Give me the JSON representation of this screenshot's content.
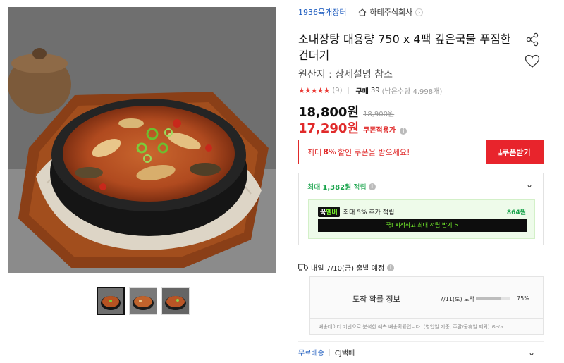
{
  "breadcrumb": {
    "brand": "1936육개장터",
    "seller": "하테주식회사"
  },
  "product": {
    "title": "소내장탕 대용량 750 x 4팩 깊은국물 푸짐한 건더기",
    "origin": "원산지 : 상세설명 참조",
    "rating_stars": "★★★★★",
    "review_count": "(9)",
    "purchase_label": "구매",
    "purchase_count": "39",
    "remaining": "(남은수량 4,998개)",
    "price": "18,800원",
    "original_price": "18,900원",
    "coupon_price": "17,290원",
    "coupon_tag": "쿠폰적용가"
  },
  "coupon_banner": {
    "text_prefix": "최대",
    "text_percent": "8%",
    "text_suffix": "할인 쿠폰을 받으세요!",
    "button_label": "⤓쿠폰받기"
  },
  "reward": {
    "prefix": "최대",
    "amount": "1,382원",
    "suffix": "적립",
    "member_logo_a": "꾹",
    "member_logo_b": "멤버",
    "member_desc": "최대 5% 추가 적립",
    "member_amount": "864원",
    "member_cta": "꾹! 시작하고 최대 적립 받기 >"
  },
  "shipping": {
    "dispatch": "내일 7/10(금) 출발 예정",
    "arrival_title": "도착 확률 정보",
    "arrival_date": "7/11(토) 도착",
    "arrival_probability_pct": 75,
    "arrival_pct_label": "75%",
    "arrival_note": "배송데이터 기반으로 분석한 예측 배송확률입니다. (영업일 기준, 주말/공휴일 제외)",
    "beta_label": "Beta",
    "free_shipping": "무료배송",
    "carrier": "CJ택배"
  },
  "icons": {
    "seller": "home-icon",
    "share": "share-icon",
    "wishlist": "heart-icon",
    "info": "info-icon",
    "truck": "truck-icon",
    "expand": "chevron-down-icon"
  },
  "colors": {
    "accent_red": "#e8242c",
    "brand_blue": "#1c5bbf",
    "reward_green": "#17a34a",
    "member_bg": "#eefbea"
  }
}
